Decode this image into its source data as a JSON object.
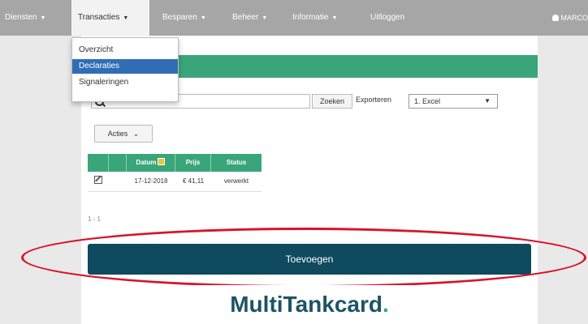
{
  "nav": {
    "items": [
      {
        "label": "Diensten"
      },
      {
        "label": "Transacties"
      },
      {
        "label": "Besparen"
      },
      {
        "label": "Beheer"
      },
      {
        "label": "Informatie"
      },
      {
        "label": "Uitloggen"
      }
    ],
    "user": "MARCO"
  },
  "dropdown": {
    "items": [
      {
        "label": "Overzicht"
      },
      {
        "label": "Declaraties"
      },
      {
        "label": "Signaleringen"
      }
    ]
  },
  "toolbar": {
    "search_value": "",
    "search_button": "Zoeken",
    "export_label": "Exporteren",
    "export_selected": "1. Excel"
  },
  "actions": {
    "label": "Acties"
  },
  "table": {
    "columns": [
      "",
      "",
      "Datum",
      "Prijs",
      "Status"
    ],
    "rows": [
      {
        "date": "17-12-2018",
        "price": "€ 41,11",
        "status": "verwerkt"
      }
    ]
  },
  "pager": {
    "text": "1 - 1"
  },
  "add_button": {
    "label": "Toevoegen"
  },
  "brand": {
    "name": "MultiTankcard",
    "dot": "."
  },
  "colors": {
    "navbar": "#a6a6a6",
    "green": "#3aa57a",
    "button_dark": "#0f4a5e",
    "highlight": "#d8132a",
    "dropdown_selected": "#2f6eb5"
  }
}
